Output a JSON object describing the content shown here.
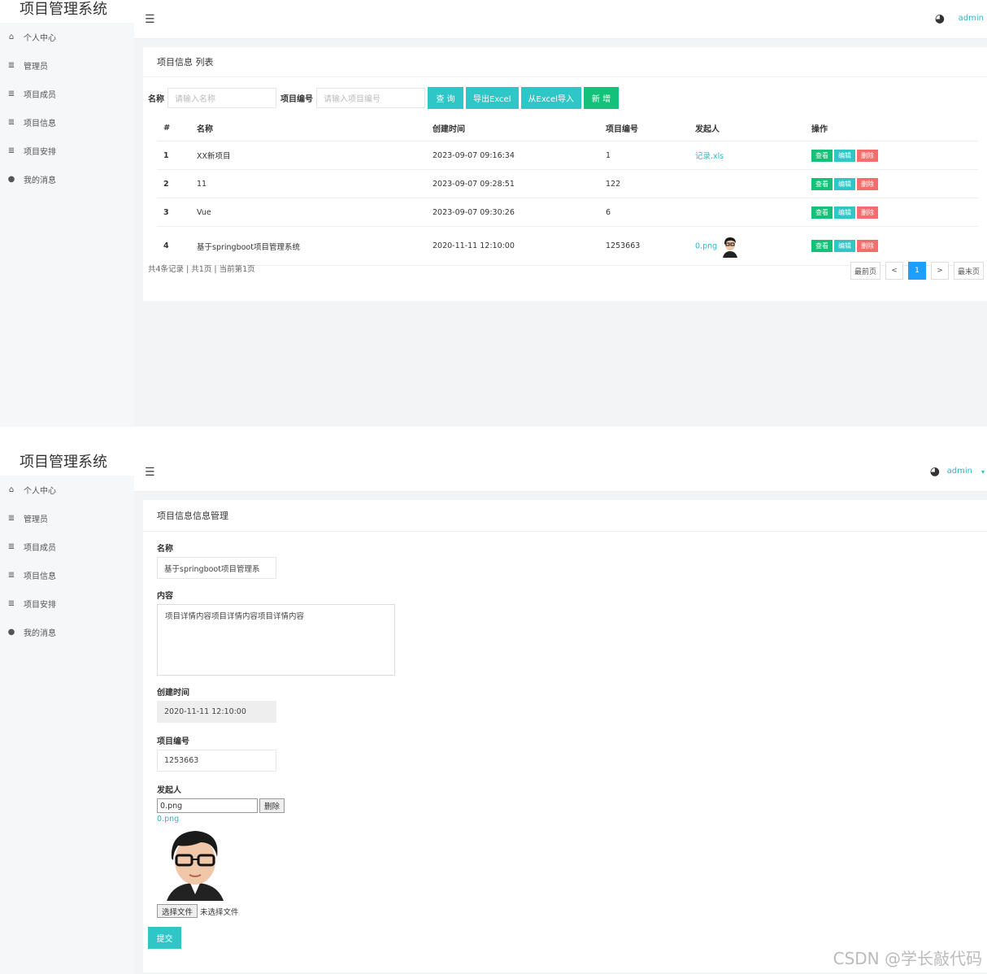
{
  "app": {
    "title": "项目管理系统",
    "user": "admin"
  },
  "sidebar": {
    "items": [
      {
        "label": "个人中心",
        "icon": "home-icon"
      },
      {
        "label": "管理员",
        "icon": "list-icon"
      },
      {
        "label": "项目成员",
        "icon": "list-icon"
      },
      {
        "label": "项目信息",
        "icon": "list-icon"
      },
      {
        "label": "项目安排",
        "icon": "list-icon"
      },
      {
        "label": "我的消息",
        "icon": "user-icon"
      }
    ]
  },
  "list_page": {
    "card_title": "项目信息 列表",
    "search": {
      "name_label": "名称",
      "name_placeholder": "请输入名称",
      "code_label": "项目编号",
      "code_placeholder": "请输入项目编号",
      "query_btn": "查 询",
      "export_btn": "导出Excel",
      "import_btn": "从Excel导入",
      "add_btn": "新 增"
    },
    "table": {
      "headers": [
        "#",
        "名称",
        "创建时间",
        "项目编号",
        "发起人",
        "操作"
      ],
      "rows": [
        {
          "idx": "1",
          "name": "XX新项目",
          "time": "2023-09-07 09:16:34",
          "code": "1",
          "initiator": "记录.xls",
          "has_avatar": false
        },
        {
          "idx": "2",
          "name": "11",
          "time": "2023-09-07 09:28:51",
          "code": "122",
          "initiator": "",
          "has_avatar": false
        },
        {
          "idx": "3",
          "name": "Vue",
          "time": "2023-09-07 09:30:26",
          "code": "6",
          "initiator": "",
          "has_avatar": false
        },
        {
          "idx": "4",
          "name": "基于springboot项目管理系统",
          "time": "2020-11-11 12:10:00",
          "code": "1253663",
          "initiator": "0.png",
          "has_avatar": true
        }
      ],
      "ops": {
        "view": "查看",
        "edit": "编辑",
        "del": "删除"
      }
    },
    "footer": "共4条记录 | 共1页 | 当前第1页",
    "pager": {
      "first": "最前页",
      "prev": "<",
      "current": "1",
      "next": ">",
      "last": "最末页"
    }
  },
  "form_page": {
    "card_title": "项目信息信息管理",
    "name_label": "名称",
    "name_value": "基于springboot项目管理系",
    "content_label": "内容",
    "content_value": "项目详情内容项目详情内容项目详情内容",
    "time_label": "创建时间",
    "time_value": "2020-11-11 12:10:00",
    "code_label": "项目编号",
    "code_value": "1253663",
    "initiator_label": "发起人",
    "initiator_file": "0.png",
    "delete_btn": "删除",
    "file_link": "0.png",
    "choose_btn": "选择文件",
    "no_file": "未选择文件",
    "submit_btn": "提交"
  },
  "watermark": "CSDN @学长敲代码"
}
